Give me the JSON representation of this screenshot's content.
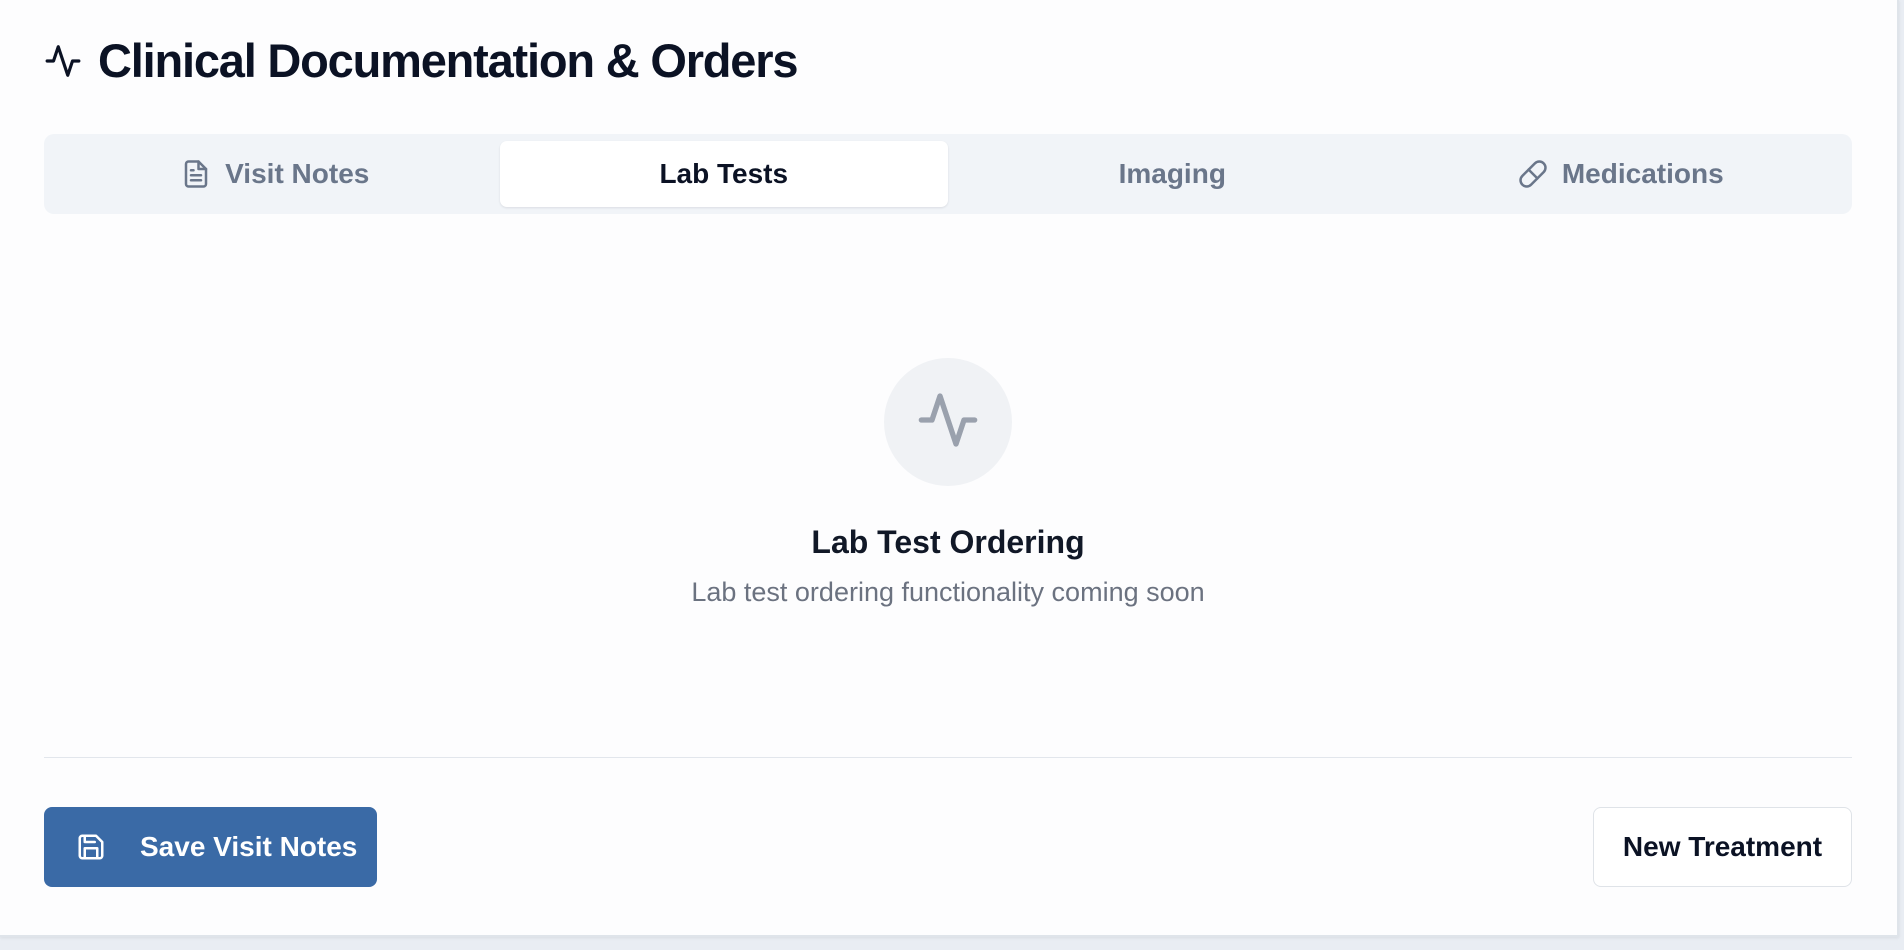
{
  "header": {
    "title": "Clinical Documentation & Orders",
    "icon": "activity-icon"
  },
  "tabs": [
    {
      "label": "Visit Notes",
      "icon": "file-text-icon",
      "active": false
    },
    {
      "label": "Lab Tests",
      "icon": null,
      "active": true
    },
    {
      "label": "Imaging",
      "icon": null,
      "active": false
    },
    {
      "label": "Medications",
      "icon": "pill-icon",
      "active": false
    }
  ],
  "empty_state": {
    "icon": "activity-icon",
    "title": "Lab Test Ordering",
    "description": "Lab test ordering functionality coming soon"
  },
  "footer": {
    "save_label": "Save Visit Notes",
    "save_icon": "save-icon",
    "new_treatment_label": "New Treatment"
  },
  "colors": {
    "primary": "#3a6aa6",
    "title": "#0b1224",
    "muted": "#6a768a",
    "tab_bar_bg": "#f1f4f8"
  }
}
